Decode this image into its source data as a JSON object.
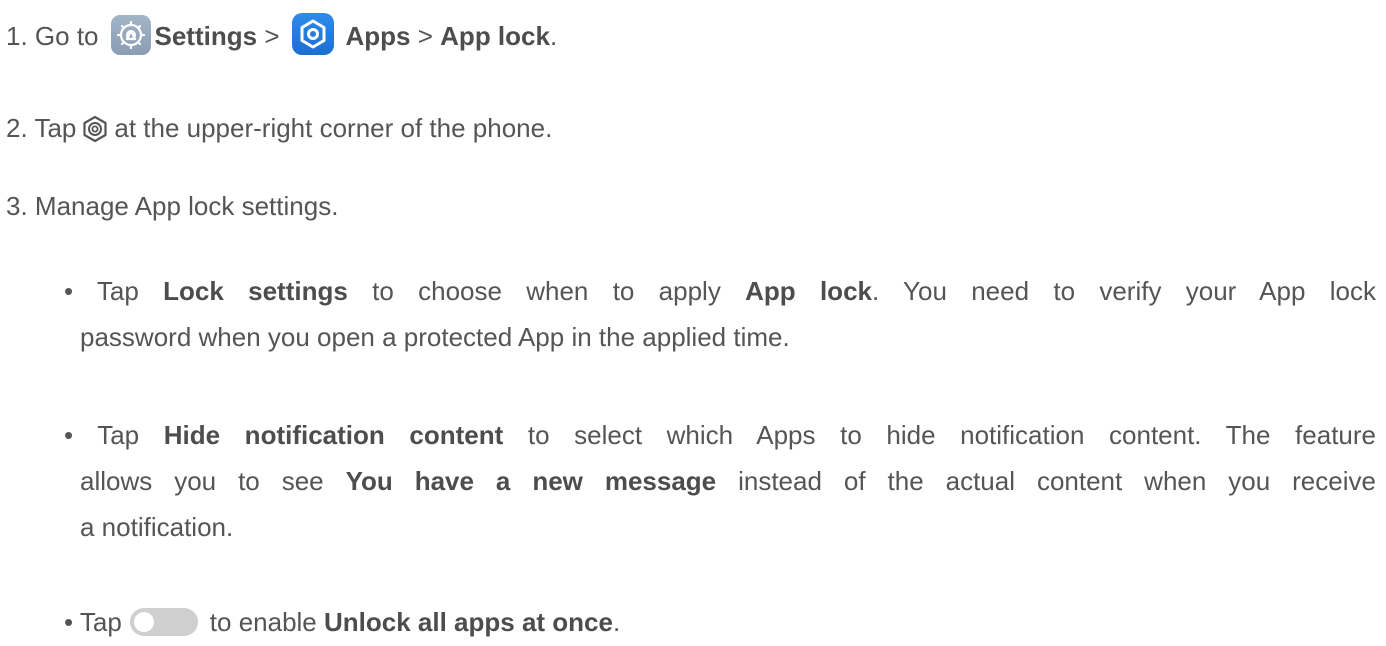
{
  "step1": {
    "prefix": "1. Go to",
    "settings_label": "Settings",
    "sep1": ">",
    "apps_label": "Apps",
    "sep2": ">",
    "applock_label": "App lock",
    "period": "."
  },
  "step2": {
    "prefix": "2. Tap",
    "suffix": "at the upper-right corner of the phone."
  },
  "step3": {
    "text": "3. Manage App lock settings."
  },
  "bullet1": {
    "lead": "• Tap",
    "term1": "Lock settings",
    "mid": "to choose when to apply",
    "term2": "App lock",
    "tail": ". You need to verify your App lock",
    "line2": "password when you open a protected App in the applied time."
  },
  "bullet2": {
    "lead": "• Tap",
    "term1": "Hide notification content",
    "tail": "to select which Apps to hide notification content. The feature",
    "line2_lead": "allows you to see",
    "term2": "You have a new message",
    "line2_tail": "instead of the actual content when you receive",
    "line3": "a notification."
  },
  "bullet3": {
    "lead": "• Tap",
    "mid": "to enable",
    "term": "Unlock all apps at once",
    "period": "."
  },
  "colors": {
    "text": "#555555",
    "settings_icon": "#94a7bd",
    "apps_icon": "#1f78dd",
    "toggle": "#cfcfcf"
  },
  "icons": {
    "settings": "settings-gear-icon",
    "apps": "apps-hexagon-icon",
    "gear": "hexagon-gear-icon",
    "toggle": "toggle-off-icon"
  }
}
